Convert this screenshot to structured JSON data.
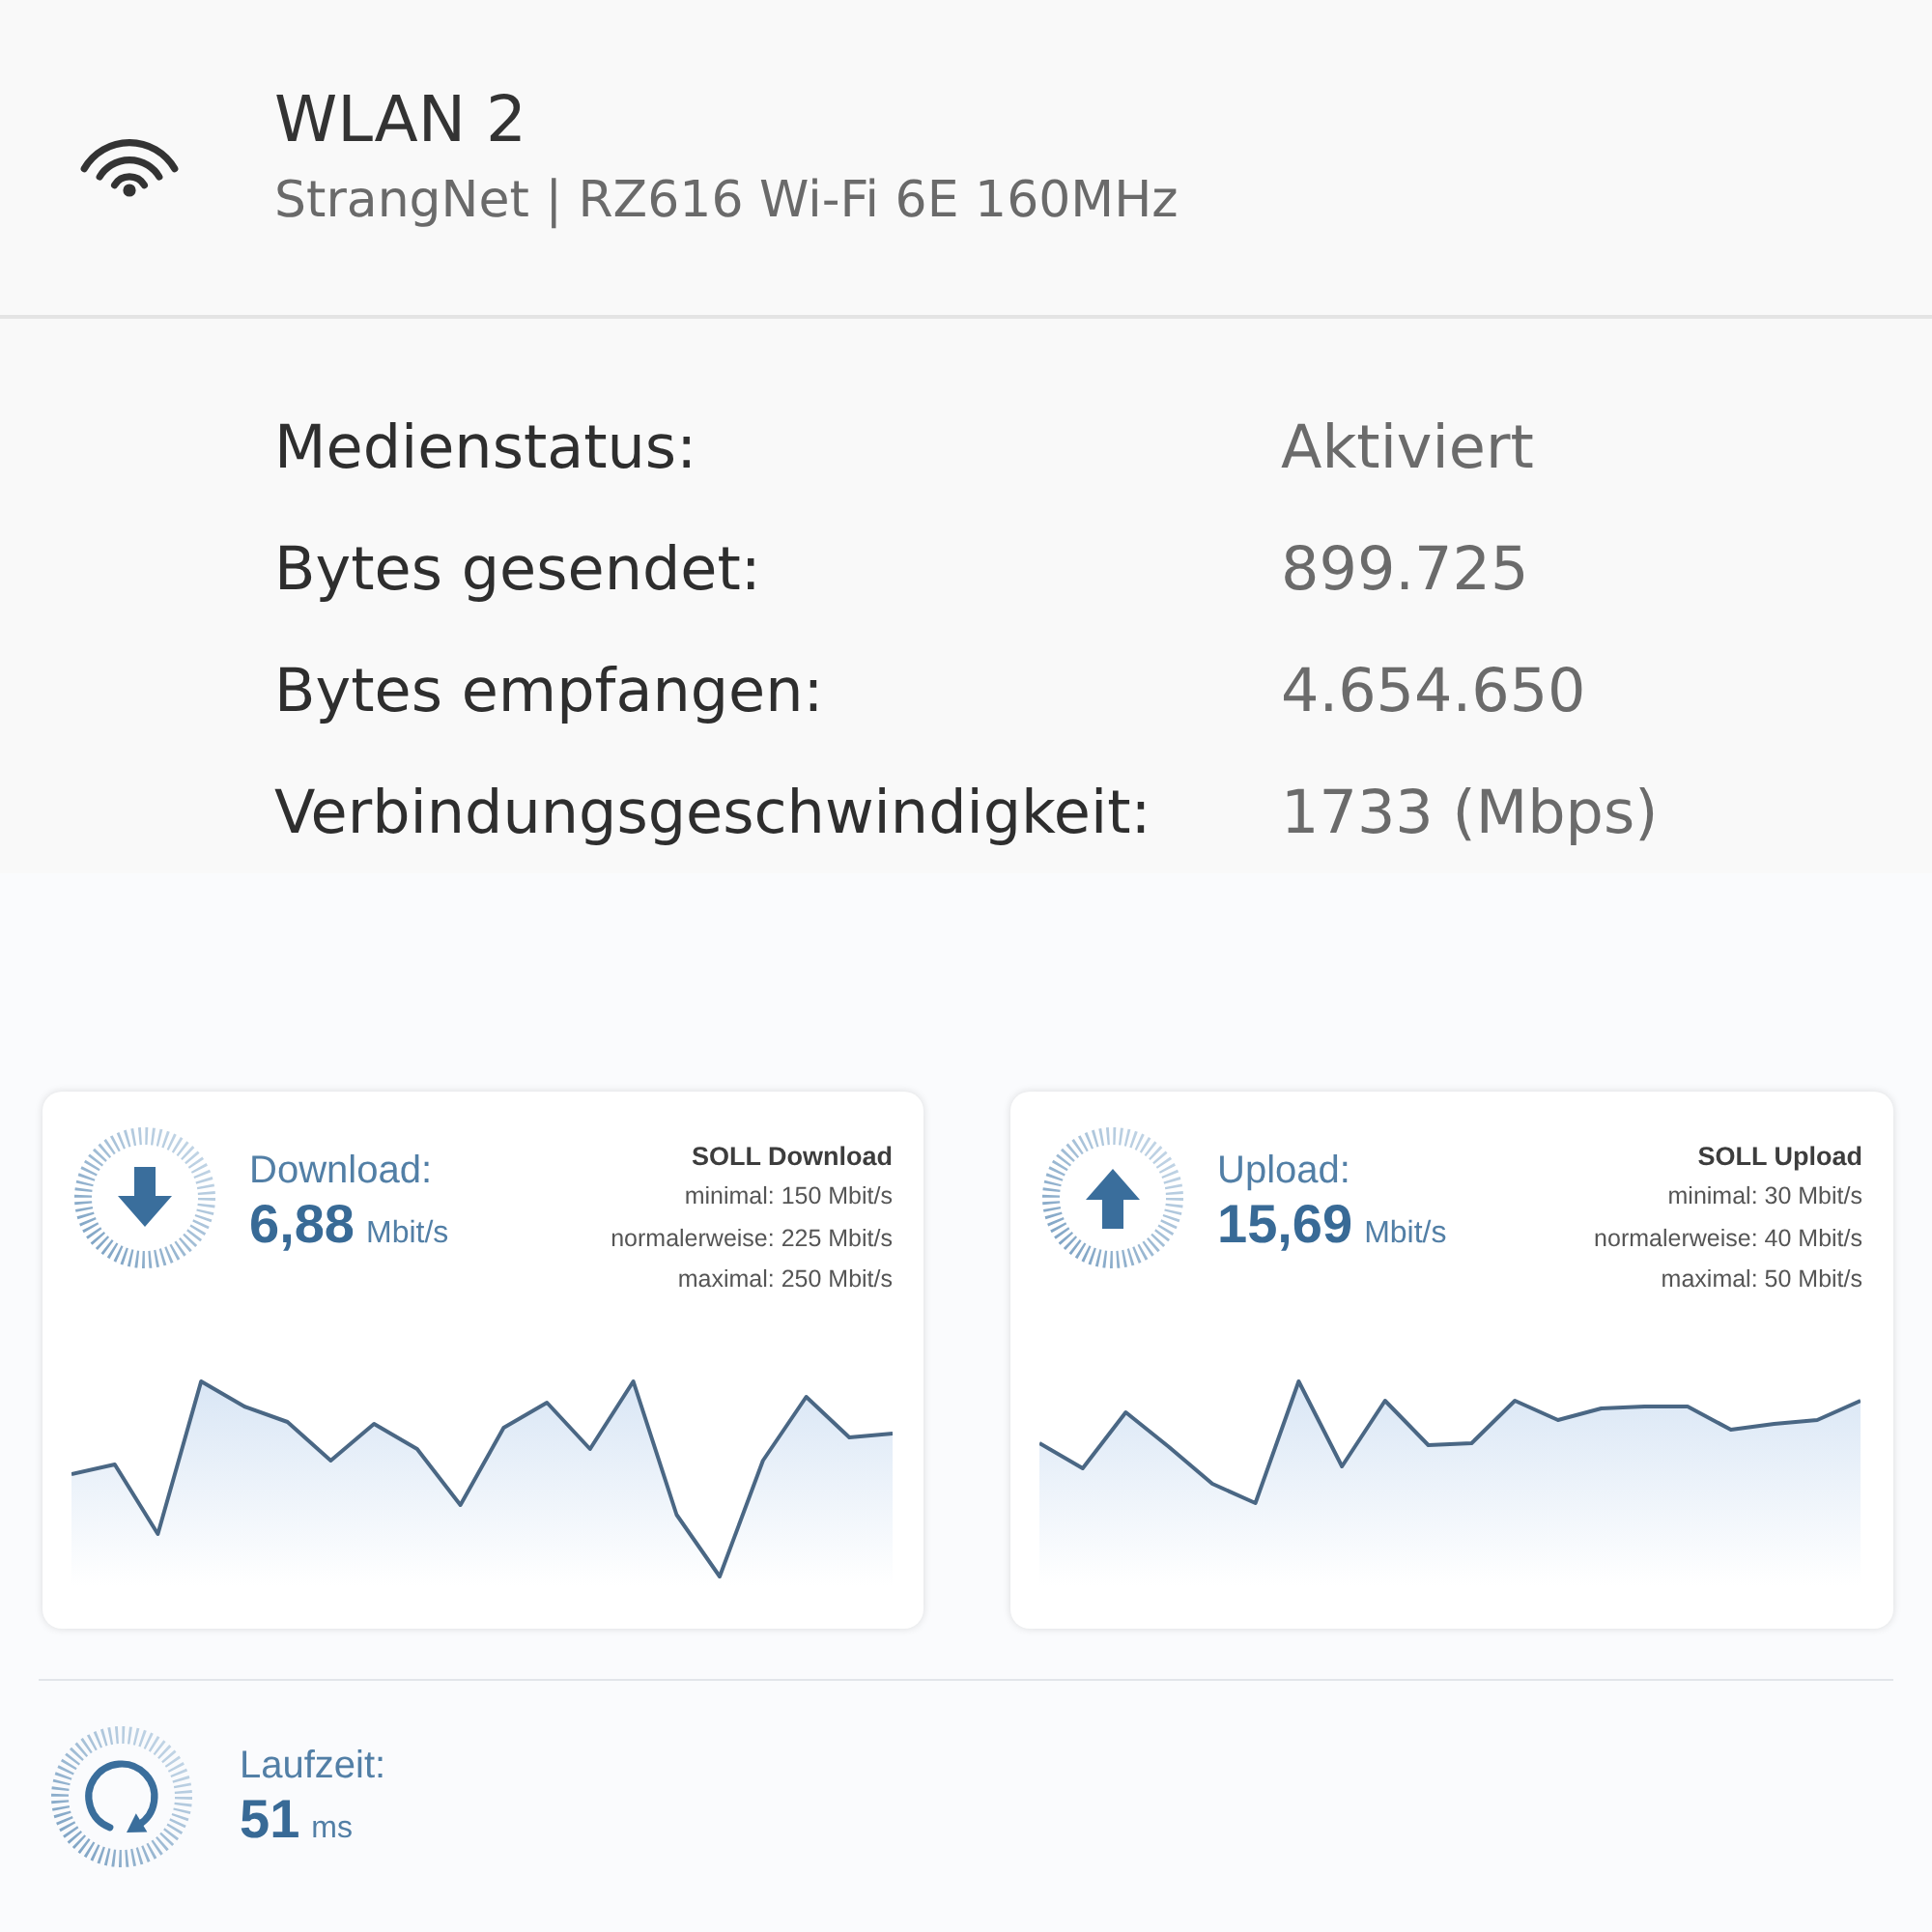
{
  "network": {
    "title": "WLAN 2",
    "subtitle": "StrangNet | RZ616 Wi-Fi 6E 160MHz"
  },
  "details": [
    {
      "label": "Medienstatus:",
      "value": "Aktiviert"
    },
    {
      "label": "Bytes gesendet:",
      "value": "899.725"
    },
    {
      "label": "Bytes empfangen:",
      "value": "4.654.650"
    },
    {
      "label": "Verbindungsgeschwindigkeit:",
      "value": "1733 (Mbps)"
    }
  ],
  "speed_cards": [
    {
      "kind": "download",
      "label": "Download:",
      "value": "6,88",
      "unit": "Mbit/s",
      "target": {
        "title": "SOLL Download",
        "lines": [
          "minimal: 150 Mbit/s",
          "normalerweise: 225 Mbit/s",
          "maximal: 250 Mbit/s"
        ]
      }
    },
    {
      "kind": "upload",
      "label": "Upload:",
      "value": "15,69",
      "unit": "Mbit/s",
      "target": {
        "title": "SOLL Upload",
        "lines": [
          "minimal: 30 Mbit/s",
          "normalerweise: 40 Mbit/s",
          "maximal: 50 Mbit/s"
        ]
      }
    }
  ],
  "latency": {
    "label": "Laufzeit:",
    "value": "51",
    "unit": "ms"
  }
}
